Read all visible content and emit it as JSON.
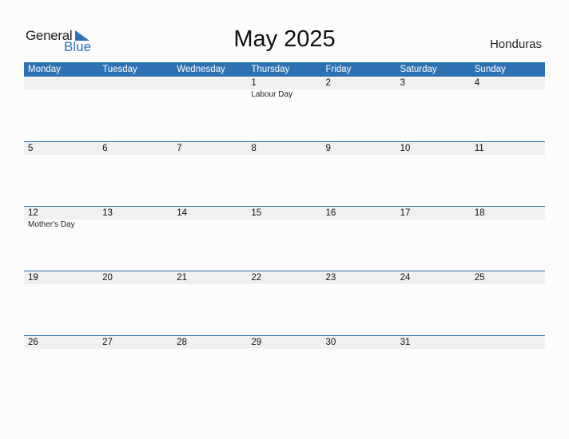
{
  "logo": {
    "general": "General",
    "blue": "Blue"
  },
  "title": "May 2025",
  "country": "Honduras",
  "colors": {
    "accent": "#2e71b2",
    "band": "#f0f0f0"
  },
  "weekdays": [
    "Monday",
    "Tuesday",
    "Wednesday",
    "Thursday",
    "Friday",
    "Saturday",
    "Sunday"
  ],
  "weeks": [
    [
      {
        "d": ""
      },
      {
        "d": ""
      },
      {
        "d": ""
      },
      {
        "d": "1",
        "e": "Labour Day"
      },
      {
        "d": "2"
      },
      {
        "d": "3"
      },
      {
        "d": "4"
      }
    ],
    [
      {
        "d": "5"
      },
      {
        "d": "6"
      },
      {
        "d": "7"
      },
      {
        "d": "8"
      },
      {
        "d": "9"
      },
      {
        "d": "10"
      },
      {
        "d": "11"
      }
    ],
    [
      {
        "d": "12",
        "e": "Mother's Day"
      },
      {
        "d": "13"
      },
      {
        "d": "14"
      },
      {
        "d": "15"
      },
      {
        "d": "16"
      },
      {
        "d": "17"
      },
      {
        "d": "18"
      }
    ],
    [
      {
        "d": "19"
      },
      {
        "d": "20"
      },
      {
        "d": "21"
      },
      {
        "d": "22"
      },
      {
        "d": "23"
      },
      {
        "d": "24"
      },
      {
        "d": "25"
      }
    ],
    [
      {
        "d": "26"
      },
      {
        "d": "27"
      },
      {
        "d": "28"
      },
      {
        "d": "29"
      },
      {
        "d": "30"
      },
      {
        "d": "31"
      },
      {
        "d": ""
      }
    ]
  ]
}
